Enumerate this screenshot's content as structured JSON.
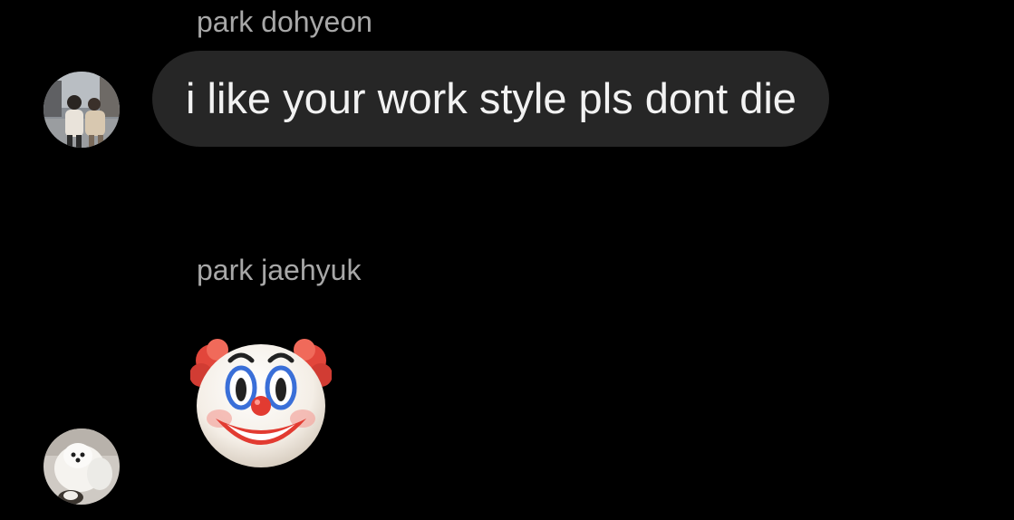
{
  "conversation": {
    "messages": [
      {
        "sender": "park dohyeon",
        "text": "i like your work style pls dont die",
        "avatar_icon": "profile-photo-two-people"
      },
      {
        "sender": "park jaehyuk",
        "emoji": "clown-face",
        "avatar_icon": "profile-photo-white-dog"
      }
    ]
  },
  "colors": {
    "background": "#000000",
    "bubble": "#262626",
    "sender_name": "#a8a8a8",
    "message_text": "#f2f2f2"
  }
}
